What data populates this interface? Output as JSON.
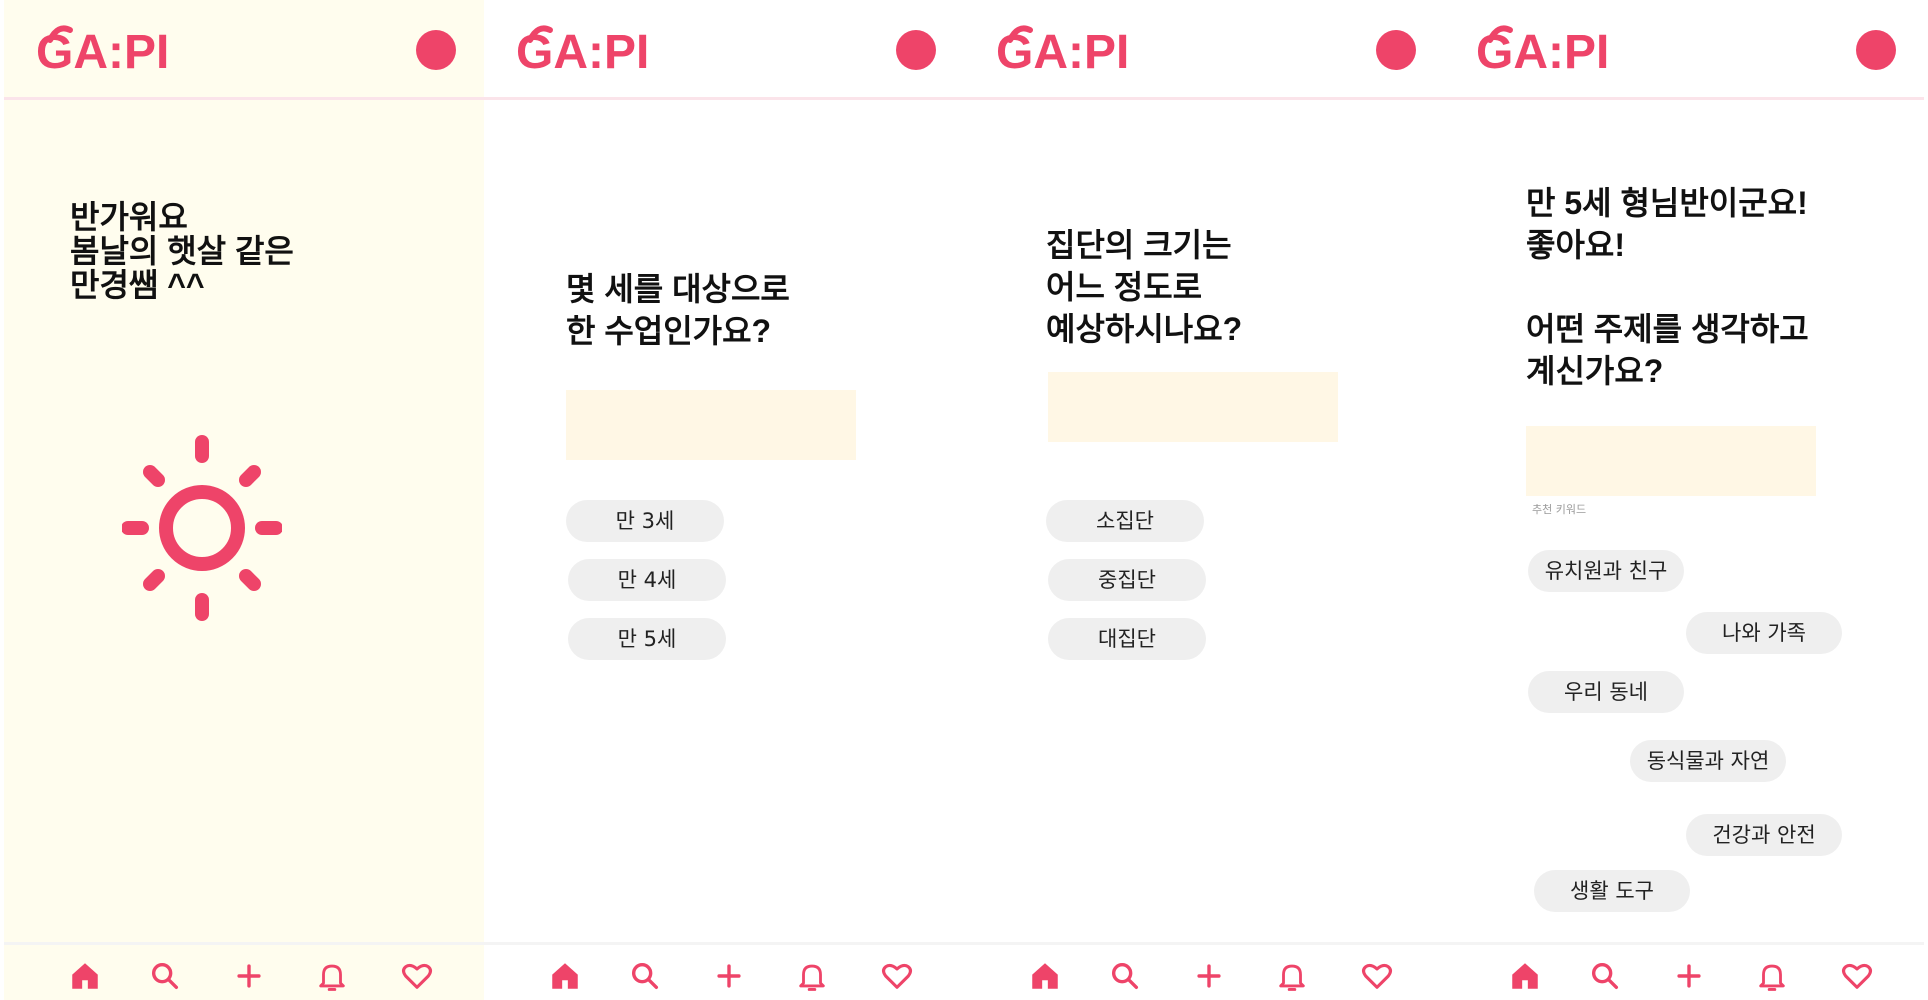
{
  "app": {
    "logo_text": "GA:PI",
    "accent_color": "#ee4469",
    "logo_color": "#ee4469",
    "logo_accent_color": "#f7c9a0"
  },
  "nav": {
    "icons": [
      "home-icon",
      "search-icon",
      "plus-icon",
      "bell-icon",
      "heart-icon"
    ]
  },
  "screen1": {
    "greeting": "반가워요\n봄날의 햇살 같은\n만경쌤 ^^",
    "illustration": "sun-icon"
  },
  "screen2": {
    "question": "몇 세를 대상으로\n한 수업인가요?",
    "input_value": "",
    "options": [
      "만 3세",
      "만 4세",
      "만 5세"
    ]
  },
  "screen3": {
    "question": "집단의 크기는\n어느 정도로\n예상하시나요?",
    "input_value": "",
    "options": [
      "소집단",
      "중집단",
      "대집단"
    ]
  },
  "screen4": {
    "question": "만 5세 형님반이군요!\n좋아요!\n\n어떤 주제를 생각하고\n계신가요?",
    "input_value": "",
    "hint": "추천 키워드",
    "keywords": [
      "유치원과 친구",
      "나와 가족",
      "우리 동네",
      "동식물과 자연",
      "건강과 안전",
      "생활 도구"
    ]
  }
}
